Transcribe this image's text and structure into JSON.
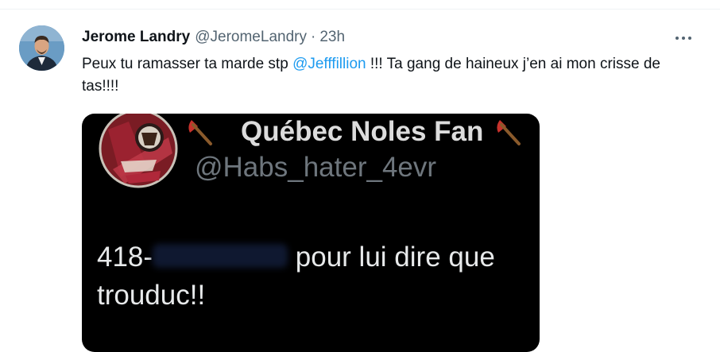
{
  "tweet": {
    "author_name": "Jerome Landry",
    "author_handle": "@JeromeLandry",
    "separator": "·",
    "time": "23h",
    "text_before": "Peux tu ramasser ta marde stp ",
    "mention": "@Jefffillion",
    "text_after": " !!! Ta gang de haineux j’en ai mon crisse de tas!!!!"
  },
  "media": {
    "name": "Québec Noles Fan",
    "handle": "@Habs_hater_4evr",
    "text_prefix": "418-",
    "text_suffix": " pour lui dire que trouduc!!"
  },
  "colors": {
    "link": "#1d9bf0",
    "secondary": "#536471",
    "media_bg": "#000000"
  },
  "icons": {
    "more": "more-dots-icon",
    "axe": "axe-icon"
  }
}
